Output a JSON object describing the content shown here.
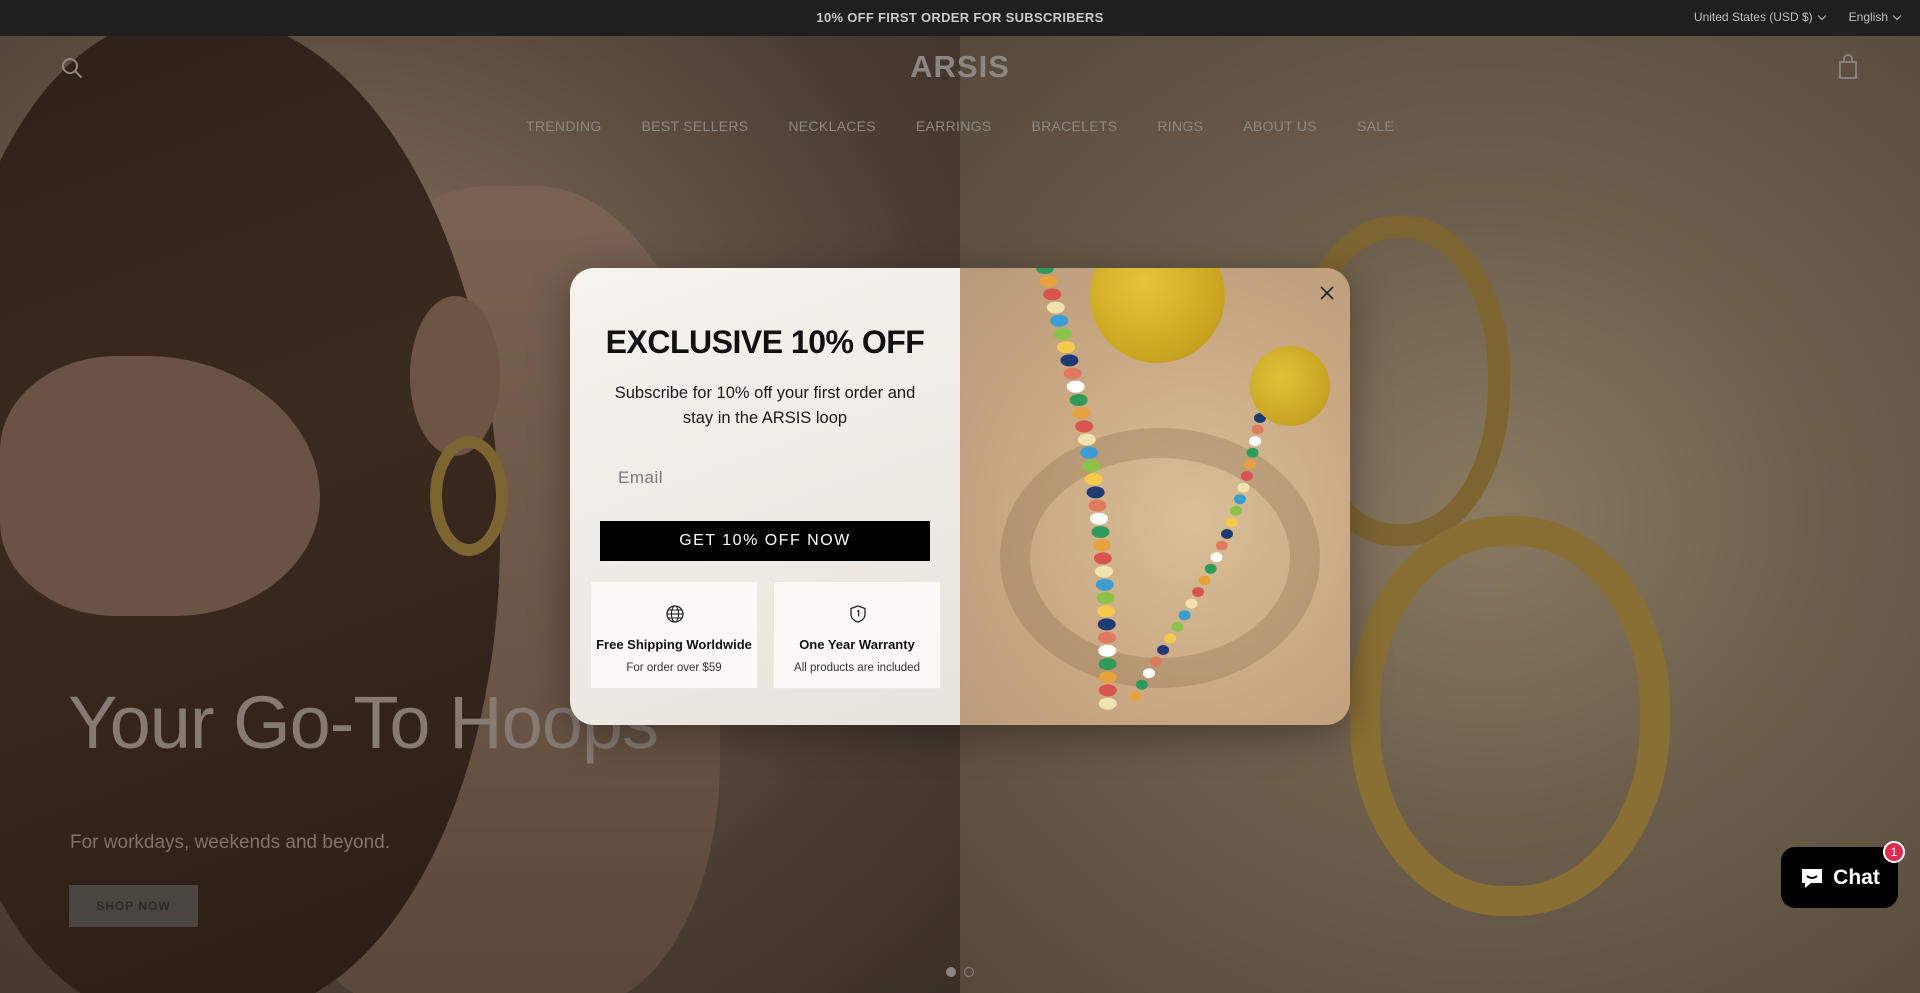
{
  "announcement": {
    "message": "10% OFF FIRST ORDER FOR SUBSCRIBERS",
    "country": "United States (USD $)",
    "language": "English"
  },
  "header": {
    "logo": "ARSIS",
    "icons": [
      "search-icon",
      "cart-icon"
    ]
  },
  "nav": {
    "items": [
      "TRENDING",
      "BEST SELLERS",
      "NECKLACES",
      "EARRINGS",
      "BRACELETS",
      "RINGS",
      "ABOUT US",
      "SALE"
    ]
  },
  "hero": {
    "title": "Your Go-To Hoops",
    "subtitle": "For workdays, weekends and beyond.",
    "button": "SHOP NOW",
    "slides": 2,
    "active_slide": 1
  },
  "modal": {
    "title": "EXCLUSIVE 10% OFF",
    "subtitle": "Subscribe for 10% off your first order and stay in the ARSIS loop",
    "email_placeholder": "Email",
    "cta": "GET 10% OFF NOW",
    "close_icon": "close-icon",
    "cards": [
      {
        "icon": "globe-icon",
        "title": "Free Shipping Worldwide",
        "subtitle": "For order over $59"
      },
      {
        "icon": "shield-icon",
        "title": "One Year Warranty",
        "subtitle": "All products are included"
      }
    ]
  },
  "chat": {
    "label": "Chat",
    "badge": "1",
    "icon": "chat-bubble-icon"
  },
  "colors": {
    "announce_bg": "#1f1f1f",
    "cta_bg": "#000000",
    "chat_badge": "#e2294f"
  }
}
